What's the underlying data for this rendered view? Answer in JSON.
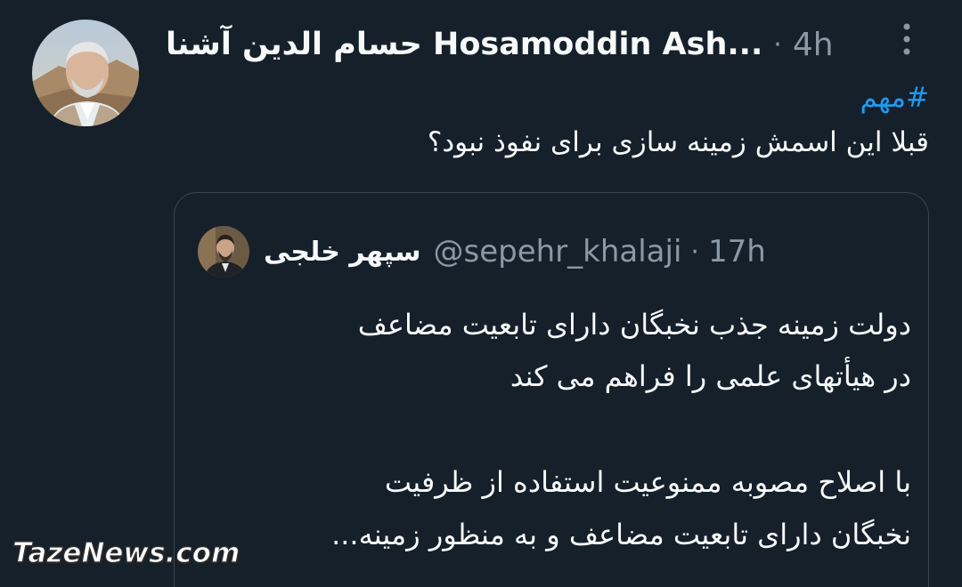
{
  "tweet": {
    "author_name": "حسام الدين آشنا Hosamoddin Ash...",
    "separator": "·",
    "time": "4h",
    "hashtag": "#مهم",
    "text": "قبلا این اسمش زمینه سازی برای نفوذ نبود؟"
  },
  "quote": {
    "name": "سپهر خلجی",
    "handle": "@sepehr_khalaji",
    "separator": "·",
    "time": "17h",
    "lines": [
      "دولت زمینه جذب نخبگان دارای تابعیت مضاعف",
      "در هیأتهای علمی را فراهم می کند",
      "با اصلاح مصوبه ممنوعیت استفاده از ظرفیت",
      "نخبگان دارای تابعیت مضاعف و به منظور زمینه..."
    ]
  },
  "watermark": "TazeNews.com",
  "icons": {
    "more": "more-vertical-icon"
  },
  "colors": {
    "background": "#15202b",
    "text": "#f7f9f9",
    "secondary": "#8b98a5",
    "link": "#1d9bf0",
    "border": "#38444d"
  }
}
